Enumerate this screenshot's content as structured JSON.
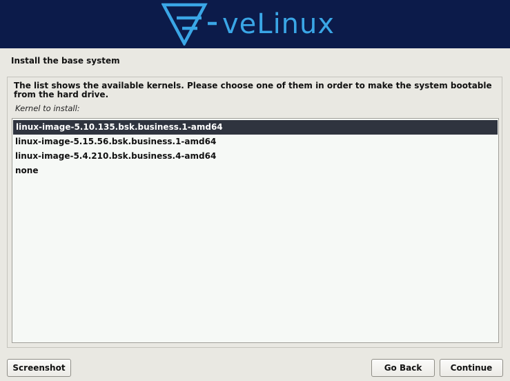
{
  "banner": {
    "logo_text": "veLinux",
    "logo_icon": "velinux-logo-icon",
    "background_color": "#0c1b4a",
    "logo_color": "#3aa6e6"
  },
  "page": {
    "title": "Install the base system",
    "description": "The list shows the available kernels. Please choose one of them in order to make the system bootable from the hard drive.",
    "list_label": "Kernel to install:"
  },
  "kernels": [
    {
      "label": "linux-image-5.10.135.bsk.business.1-amd64",
      "selected": true
    },
    {
      "label": "linux-image-5.15.56.bsk.business.1-amd64",
      "selected": false
    },
    {
      "label": "linux-image-5.4.210.bsk.business.4-amd64",
      "selected": false
    },
    {
      "label": "none",
      "selected": false
    }
  ],
  "buttons": {
    "screenshot": "Screenshot",
    "go_back": "Go Back",
    "continue": "Continue"
  },
  "colors": {
    "selection_background": "#2f343f",
    "list_background": "#f6f9f6",
    "window_background": "#e9e8e2"
  }
}
